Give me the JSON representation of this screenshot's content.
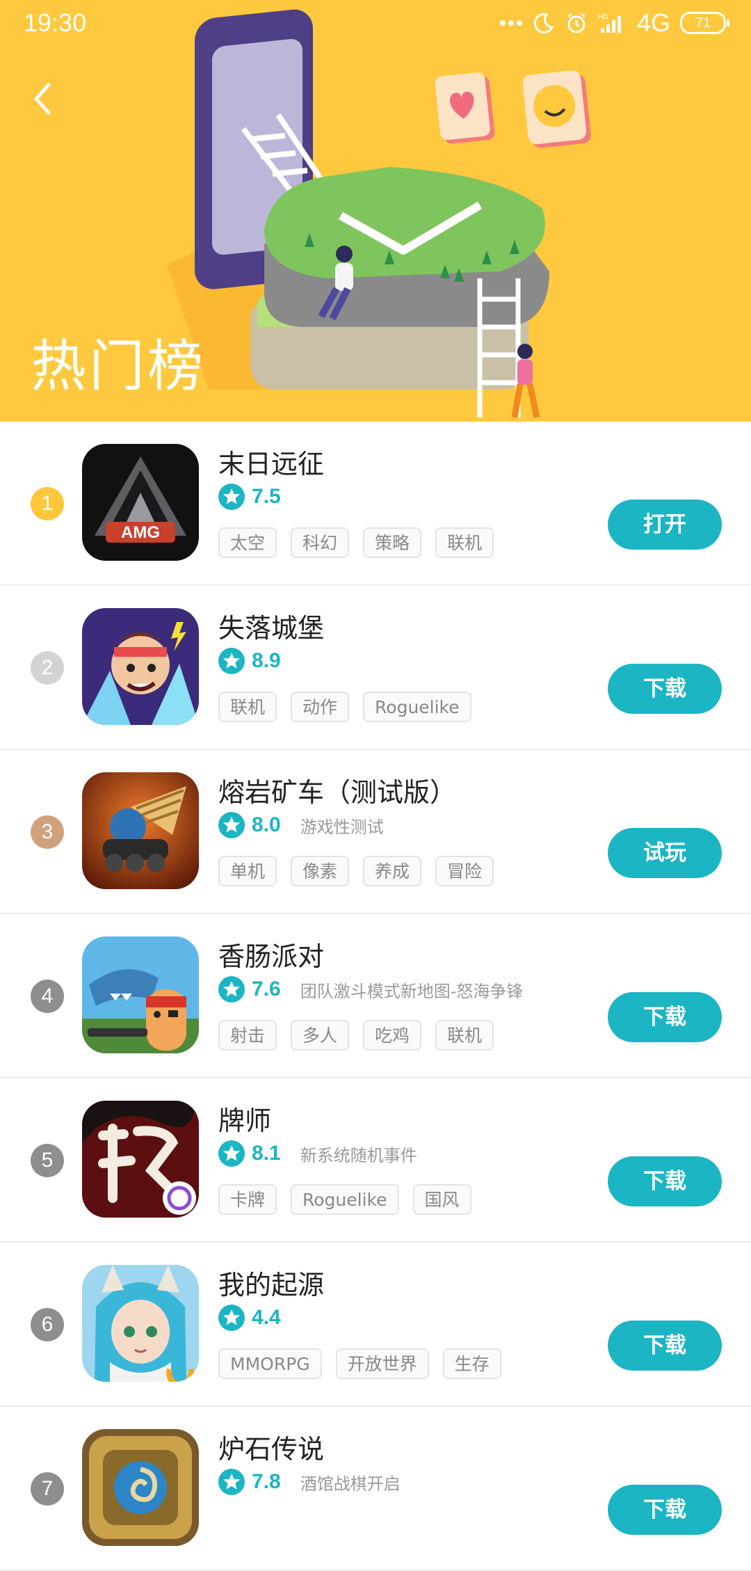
{
  "status_bar": {
    "time": "19:30",
    "network": "4G",
    "battery": "71",
    "icons": [
      "more-dots-icon",
      "moon-icon",
      "alarm-icon",
      "hd-signal-icon"
    ]
  },
  "header": {
    "back_icon": "chevron-left-icon",
    "title": "热门榜"
  },
  "colors": {
    "banner": "#FEC93E",
    "accent": "#1BB5C4",
    "rank_gold": "#FFC83A",
    "rank_silver": "#D3D3D3",
    "rank_bronze": "#D1A17C",
    "rank_default": "#8E8E8E"
  },
  "games": [
    {
      "rank": "1",
      "name": "末日远征",
      "score": "7.5",
      "subtitle": "",
      "tags": [
        "太空",
        "科幻",
        "策略",
        "联机"
      ],
      "action": "打开",
      "icon": "amg-logo-icon"
    },
    {
      "rank": "2",
      "name": "失落城堡",
      "score": "8.9",
      "subtitle": "",
      "tags": [
        "联机",
        "动作",
        "Roguelike"
      ],
      "action": "下载",
      "icon": "lost-castle-icon"
    },
    {
      "rank": "3",
      "name": "熔岩矿车（测试版）",
      "score": "8.0",
      "subtitle": "游戏性测试",
      "tags": [
        "单机",
        "像素",
        "养成",
        "冒险"
      ],
      "action": "试玩",
      "icon": "lava-minecart-icon"
    },
    {
      "rank": "4",
      "name": "香肠派对",
      "score": "7.6",
      "subtitle": "团队激斗模式新地图-怒海争锋",
      "tags": [
        "射击",
        "多人",
        "吃鸡",
        "联机"
      ],
      "action": "下载",
      "icon": "sausage-party-icon"
    },
    {
      "rank": "5",
      "name": "牌师",
      "score": "8.1",
      "subtitle": "新系统随机事件",
      "tags": [
        "卡牌",
        "Roguelike",
        "国风"
      ],
      "action": "下载",
      "icon": "paishi-icon"
    },
    {
      "rank": "6",
      "name": "我的起源",
      "score": "4.4",
      "subtitle": "",
      "tags": [
        "MMORPG",
        "开放世界",
        "生存"
      ],
      "action": "下载",
      "icon": "my-origin-icon"
    },
    {
      "rank": "7",
      "name": "炉石传说",
      "score": "7.8",
      "subtitle": "酒馆战棋开启",
      "tags": [],
      "action": "下载",
      "icon": "hearthstone-icon"
    }
  ]
}
